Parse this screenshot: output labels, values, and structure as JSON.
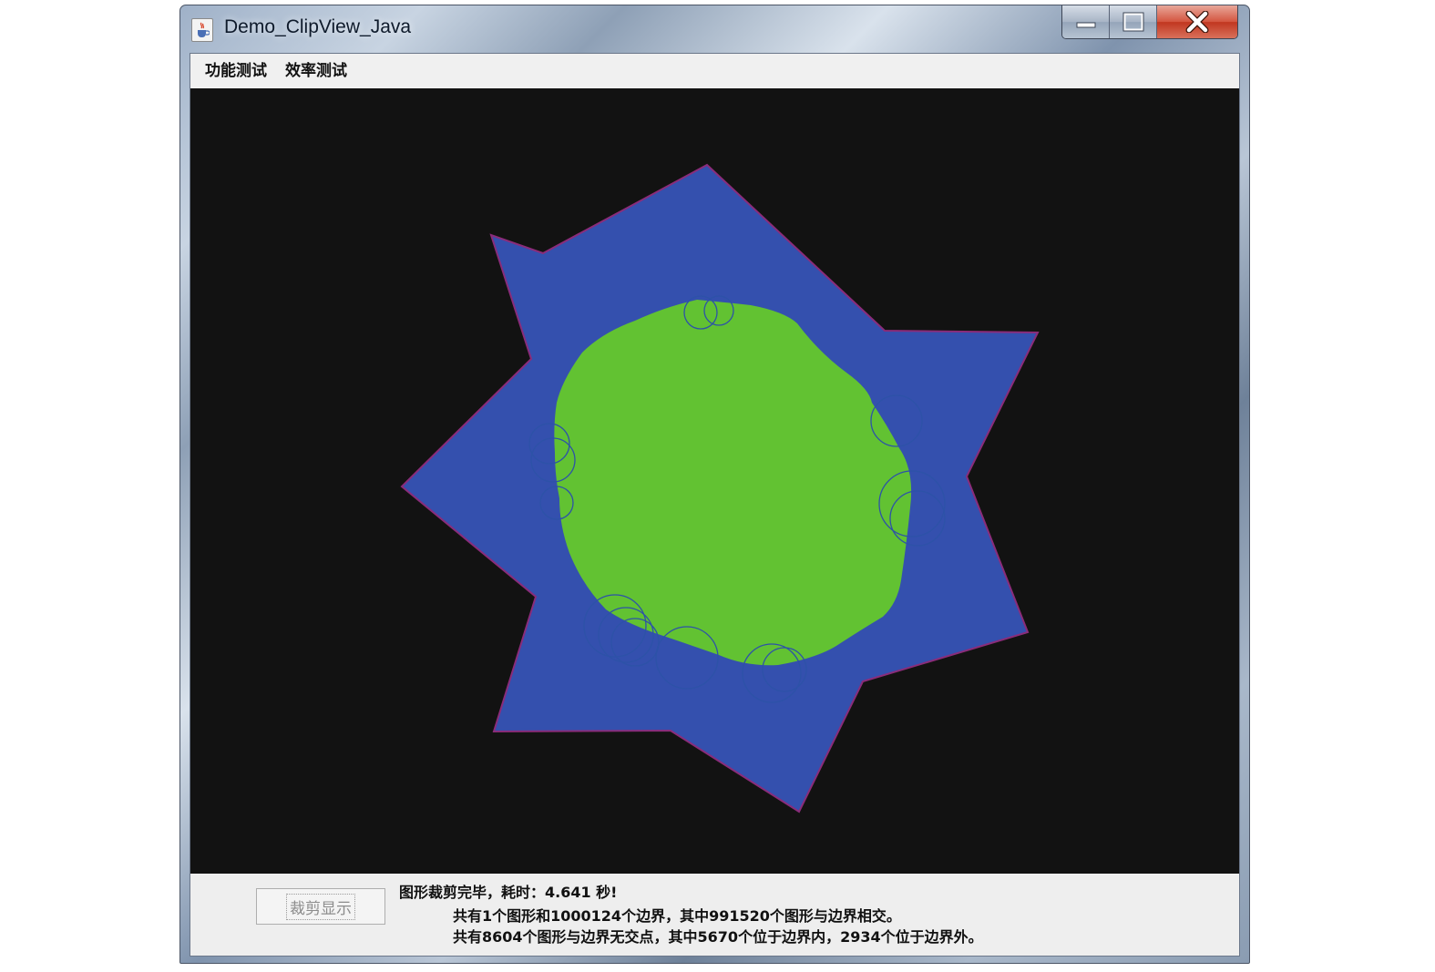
{
  "window": {
    "title": "Demo_ClipView_Java",
    "app_icon": "java-cup-icon",
    "controls": [
      "minimize-icon",
      "maximize-icon",
      "close-icon"
    ]
  },
  "menubar": {
    "items": [
      "功能测试",
      "效率测试"
    ]
  },
  "canvas": {
    "background": "#121212",
    "boundary_fill": "#3450ae",
    "boundary_stroke": "#8a2c7a",
    "clipped_fill": "#62c232",
    "circle_outline": "#2d52a8"
  },
  "statusbar": {
    "button_label": "裁剪显示",
    "line1": "图形裁剪完毕，耗时：4.641 秒!",
    "line2": "共有1个图形和1000124个边界，其中991520个图形与边界相交。",
    "line3": "共有8604个图形与边界无交点，其中5670个位于边界内，2934个位于边界外。"
  }
}
